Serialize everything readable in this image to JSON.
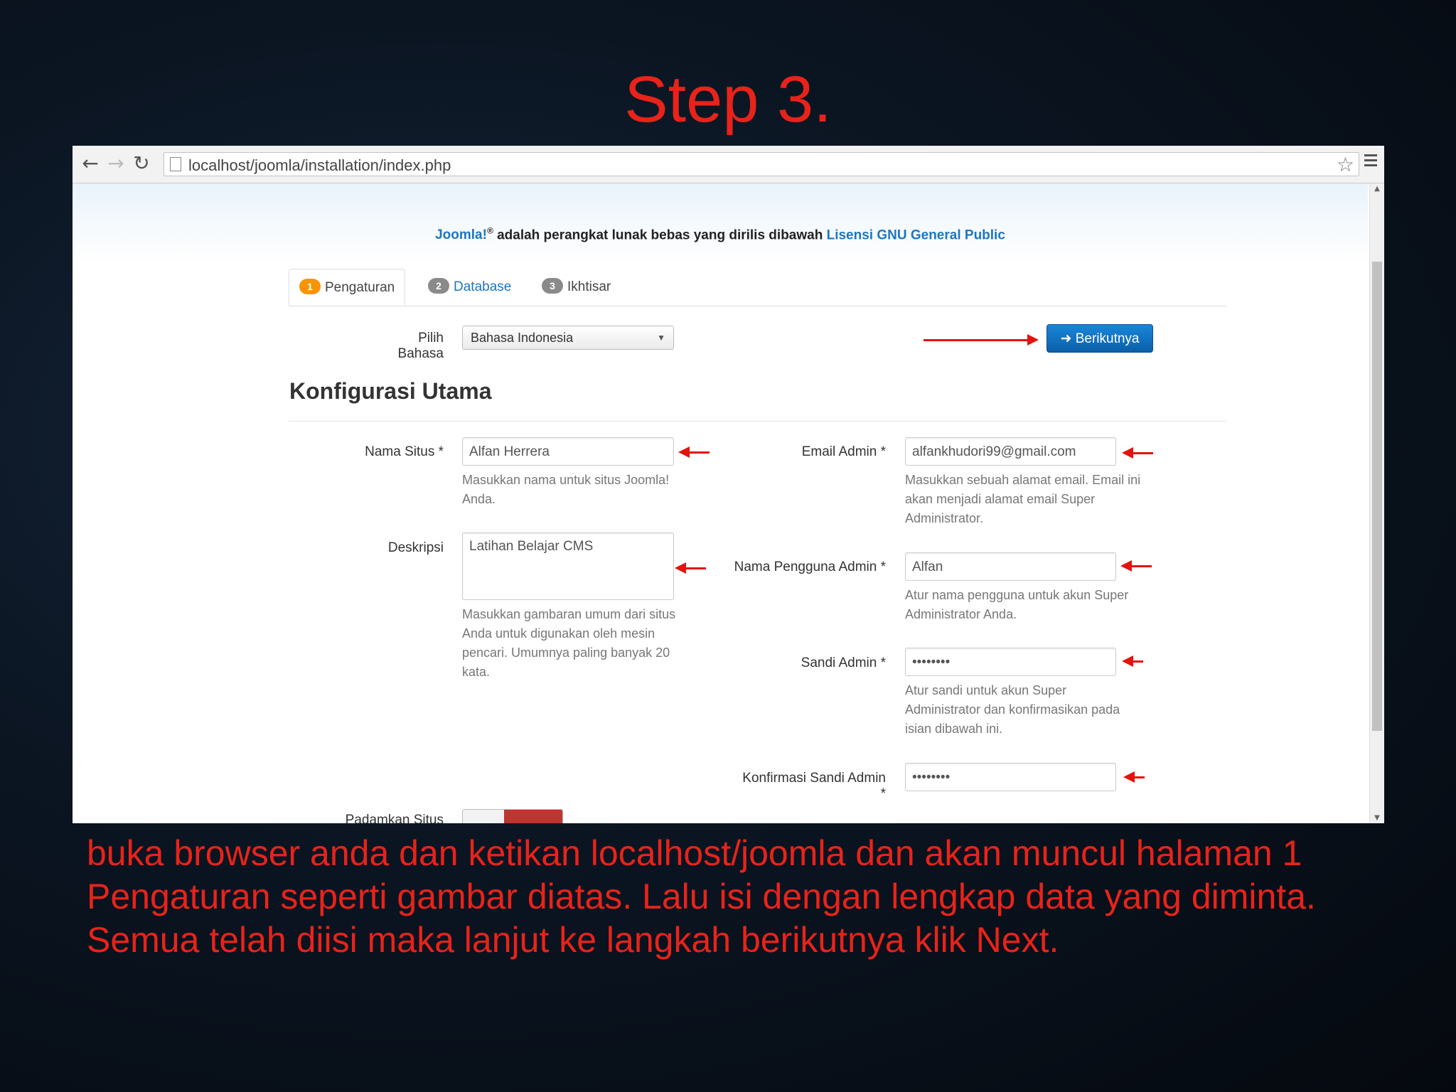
{
  "slide": {
    "title": "Step 3.",
    "caption_lines": [
      "buka browser anda dan ketikan localhost/joomla dan akan muncul halaman 1",
      "Pengaturan seperti gambar diatas. Lalu isi dengan lengkap data yang diminta.",
      "Semua telah diisi maka lanjut ke langkah berikutnya klik Next."
    ]
  },
  "browser": {
    "url": "localhost/joomla/installation/index.php"
  },
  "installer": {
    "license": {
      "joomla": "Joomla!",
      "reg": "®",
      "text": " adalah perangkat lunak bebas yang dirilis dibawah ",
      "link": "Lisensi GNU General Public"
    },
    "tabs": [
      {
        "num": "1",
        "label": "Pengaturan"
      },
      {
        "num": "2",
        "label": "Database"
      },
      {
        "num": "3",
        "label": "Ikhtisar"
      }
    ],
    "language_label": "Pilih Bahasa",
    "language_value": "Bahasa Indonesia",
    "next_button": "➜ Berikutnya",
    "section_title": "Konfigurasi Utama",
    "site_name": {
      "label": "Nama Situs *",
      "value": "Alfan Herrera",
      "help": [
        "Masukkan nama untuk situs Joomla!",
        "Anda."
      ]
    },
    "description": {
      "label": "Deskripsi",
      "value": "Latihan Belajar CMS",
      "help": [
        "Masukkan gambaran umum dari situs",
        "Anda untuk digunakan oleh mesin",
        "pencari. Umumnya paling banyak 20",
        "kata."
      ]
    },
    "admin_email": {
      "label": "Email Admin *",
      "value": "alfankhudori99@gmail.com",
      "help": [
        "Masukkan sebuah alamat email. Email ini",
        "akan menjadi alamat email Super",
        "Administrator."
      ]
    },
    "admin_username": {
      "label": "Nama Pengguna Admin *",
      "value": "Alfan",
      "help": [
        "Atur nama pengguna untuk akun Super",
        "Administrator Anda."
      ]
    },
    "admin_password": {
      "label": "Sandi Admin *",
      "value": "••••••••",
      "help": [
        "Atur sandi untuk akun Super",
        "Administrator dan konfirmasikan pada",
        "isian dibawah ini."
      ]
    },
    "confirm_password": {
      "label": "Konfirmasi Sandi Admin *",
      "value": "••••••••"
    },
    "offline_label": "Padamkan Situs"
  }
}
